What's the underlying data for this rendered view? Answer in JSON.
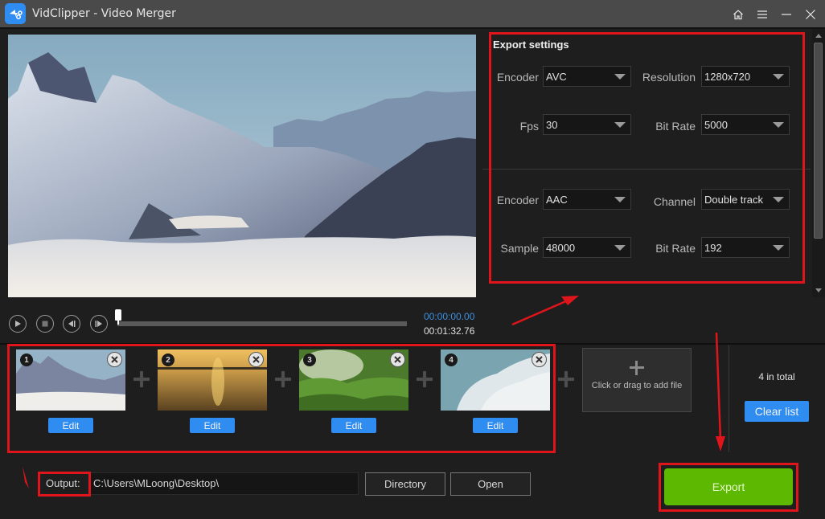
{
  "window": {
    "title": "VidClipper - Video Merger",
    "controls": [
      "home-icon",
      "menu-icon",
      "minimize-icon",
      "close-icon"
    ]
  },
  "preview": {
    "scene": "snowy mountain peaks above a sea of clouds"
  },
  "export_settings": {
    "title": "Export settings",
    "video": {
      "encoder": {
        "label": "Encoder",
        "value": "AVC"
      },
      "resolution": {
        "label": "Resolution",
        "value": "1280x720"
      },
      "fps": {
        "label": "Fps",
        "value": "30"
      },
      "bit_rate": {
        "label": "Bit Rate",
        "value": "5000"
      }
    },
    "audio": {
      "encoder": {
        "label": "Encoder",
        "value": "AAC"
      },
      "channel": {
        "label": "Channel",
        "value": "Double track"
      },
      "sample": {
        "label": "Sample",
        "value": "48000"
      },
      "bit_rate": {
        "label": "Bit Rate",
        "value": "192"
      }
    }
  },
  "playback": {
    "current_time": "00:00:00.00",
    "total_time": "00:01:32.76",
    "progress": 0,
    "buttons": [
      "play-icon",
      "stop-icon",
      "previous-frame-icon",
      "next-frame-icon"
    ]
  },
  "clips": [
    {
      "number": "1",
      "scene": "snowy mountains",
      "edit_label": "Edit"
    },
    {
      "number": "2",
      "scene": "golden sunset over sea",
      "edit_label": "Edit"
    },
    {
      "number": "3",
      "scene": "green grass close-up",
      "edit_label": "Edit"
    },
    {
      "number": "4",
      "scene": "white clouds in blue sky",
      "edit_label": "Edit"
    }
  ],
  "add_file": {
    "label": "Click or drag to add file"
  },
  "list_summary": {
    "total": "4 in total",
    "clear_label": "Clear list"
  },
  "output": {
    "label": "Output:",
    "path": "C:\\Users\\MLoong\\Desktop\\",
    "directory_label": "Directory",
    "open_label": "Open"
  },
  "export": {
    "label": "Export"
  },
  "colors": {
    "accent_blue": "#2f8cf0",
    "export_green": "#5cb800",
    "annotation_red": "#e0141b",
    "time_blue": "#3d8fe0"
  }
}
